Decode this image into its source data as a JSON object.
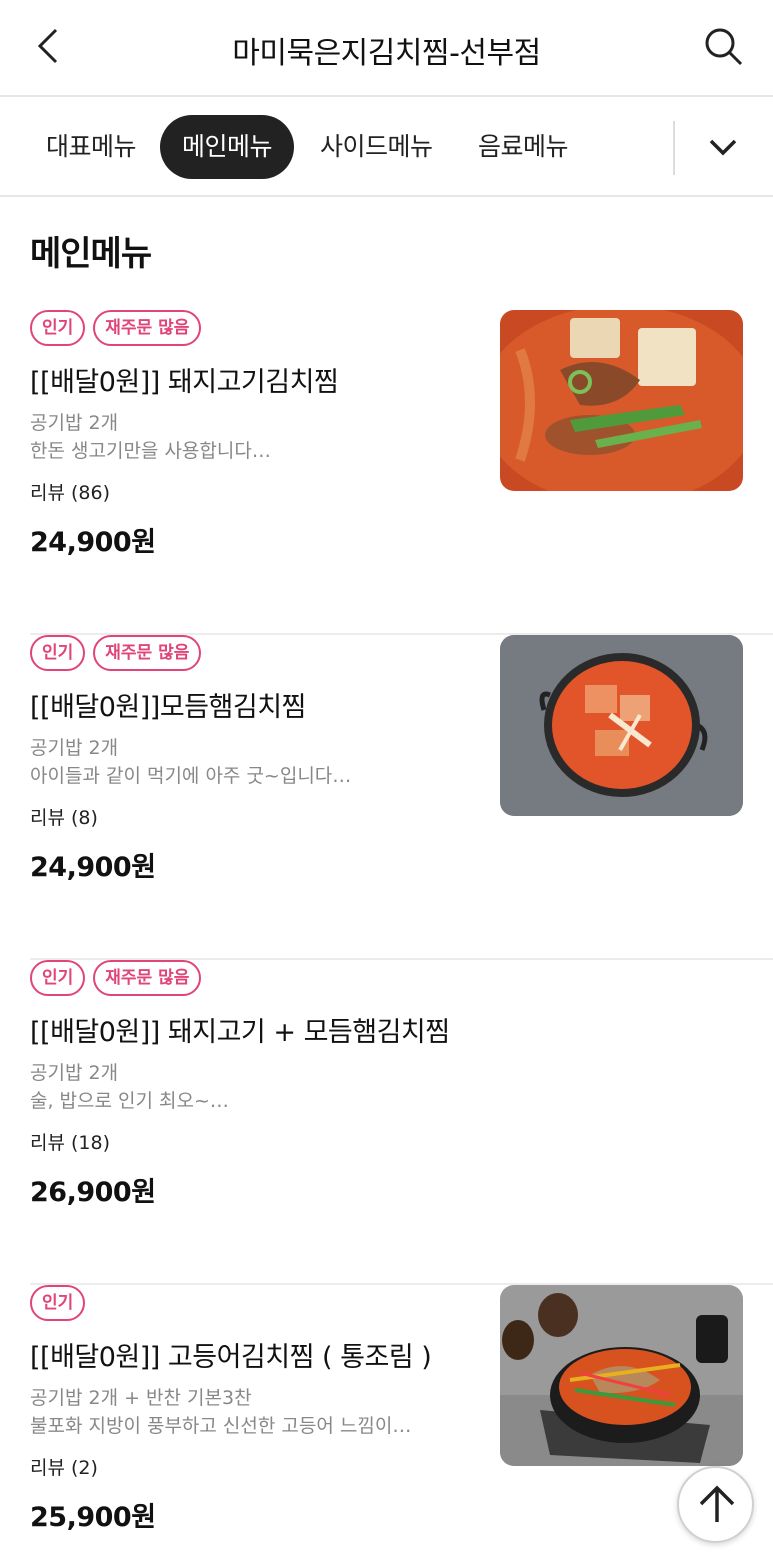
{
  "header": {
    "title": "마미묵은지김치찜-선부점",
    "back_icon": "chevron-left-icon",
    "search_icon": "search-icon"
  },
  "tabs": [
    {
      "label": "대표메뉴",
      "active": false
    },
    {
      "label": "메인메뉴",
      "active": true
    },
    {
      "label": "사이드메뉴",
      "active": false
    },
    {
      "label": "음료메뉴",
      "active": false
    }
  ],
  "tabs_more_icon": "chevron-down-icon",
  "section": {
    "title": "메인메뉴"
  },
  "items": [
    {
      "badges": [
        "인기",
        "재주문 많음"
      ],
      "name": "[[배달0원]] 돼지고기김치찜",
      "desc1": "공기밥 2개",
      "desc2": "한돈 생고기만을 사용합니다…",
      "review": "리뷰 (86)",
      "price": "24,900원"
    },
    {
      "badges": [
        "인기",
        "재주문 많음"
      ],
      "name": "[[배달0원]]모듬햄김치찜",
      "desc1": "공기밥 2개",
      "desc2": "아이들과 같이 먹기에 아주 굿~입니다…",
      "review": "리뷰 (8)",
      "price": "24,900원"
    },
    {
      "badges": [
        "인기",
        "재주문 많음"
      ],
      "name": "[[배달0원]] 돼지고기 + 모듬햄김치찜",
      "desc1": "공기밥 2개",
      "desc2": "술, 밥으로 인기 최오~…",
      "review": "리뷰 (18)",
      "price": "26,900원"
    },
    {
      "badges": [
        "인기"
      ],
      "name": "[[배달0원]] 고등어김치찜 ( 통조림 )",
      "desc1": "공기밥 2개 + 반찬 기본3찬",
      "desc2": "불포화 지방이 풍부하고 신선한 고등어 느낌이…",
      "review": "리뷰 (2)",
      "price": "25,900원"
    }
  ],
  "scroll_top_icon": "arrow-up-icon",
  "colors": {
    "accent": "#e0457a",
    "active_tab": "#222222"
  }
}
